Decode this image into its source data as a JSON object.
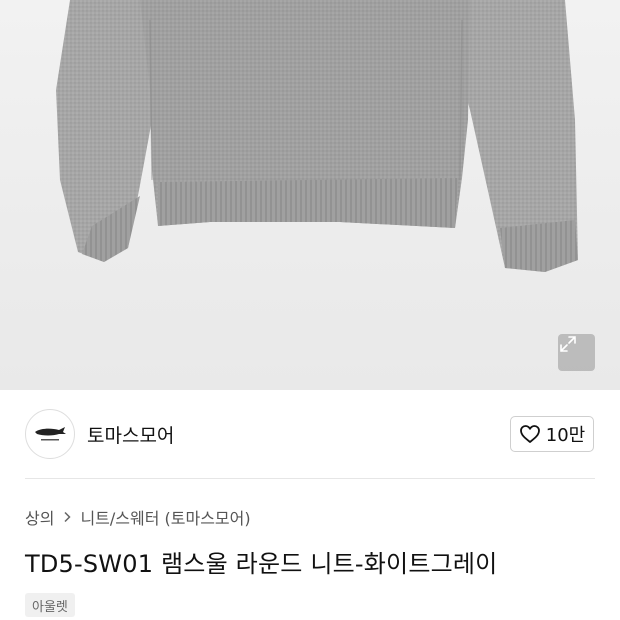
{
  "product": {
    "brand_name": "토마스모어",
    "like_count": "10만",
    "breadcrumb": [
      {
        "label": "상의"
      },
      {
        "label": "니트/스웨터 (토마스모어)"
      }
    ],
    "title": "TD5-SW01 램스울 라운드 니트-화이트그레이",
    "badge": "아울렛"
  },
  "icons": {
    "expand": "expand-arrows-icon",
    "heart": "heart-outline-icon",
    "chevron": "chevron-right-icon",
    "logo": "whale-logo"
  },
  "colors": {
    "sweater": "#a4a4a4",
    "background": "#eeeeee",
    "text_primary": "#111111",
    "text_secondary": "#555555"
  }
}
